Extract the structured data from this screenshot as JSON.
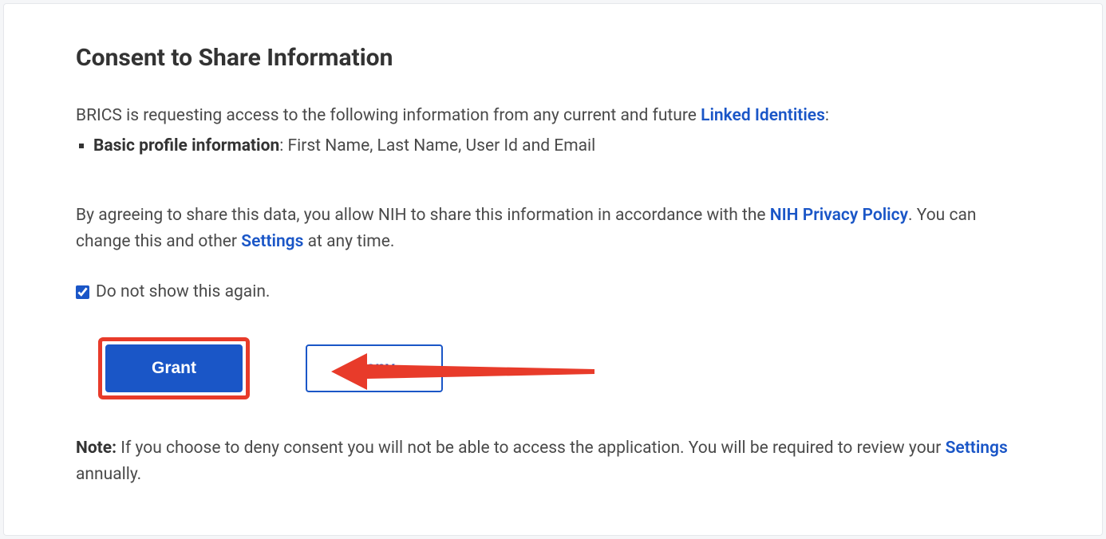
{
  "title": "Consent to Share Information",
  "intro": {
    "prefix": "BRICS is requesting access to the following information from any current and future ",
    "link": "Linked Identities",
    "suffix": ":"
  },
  "infoItem": {
    "label": "Basic profile information",
    "details": ": First Name, Last Name, User Id and Email"
  },
  "consent": {
    "part1": "By agreeing to share this data, you allow NIH to share this information in accordance with the ",
    "privacyLink": "NIH Privacy Policy",
    "part2": ". You can change this and other ",
    "settingsLink": "Settings",
    "part3": " at any time."
  },
  "checkbox": {
    "label": "Do not show this again.",
    "checked": true
  },
  "buttons": {
    "grant": "Grant",
    "deny": "Deny"
  },
  "note": {
    "label": "Note:",
    "text1": " If you choose to deny consent you will not be able to access the application. You will be required to review your ",
    "settingsLink": "Settings",
    "text2": " annually."
  },
  "colors": {
    "link": "#1a56c7",
    "highlight": "#e83b2a"
  }
}
